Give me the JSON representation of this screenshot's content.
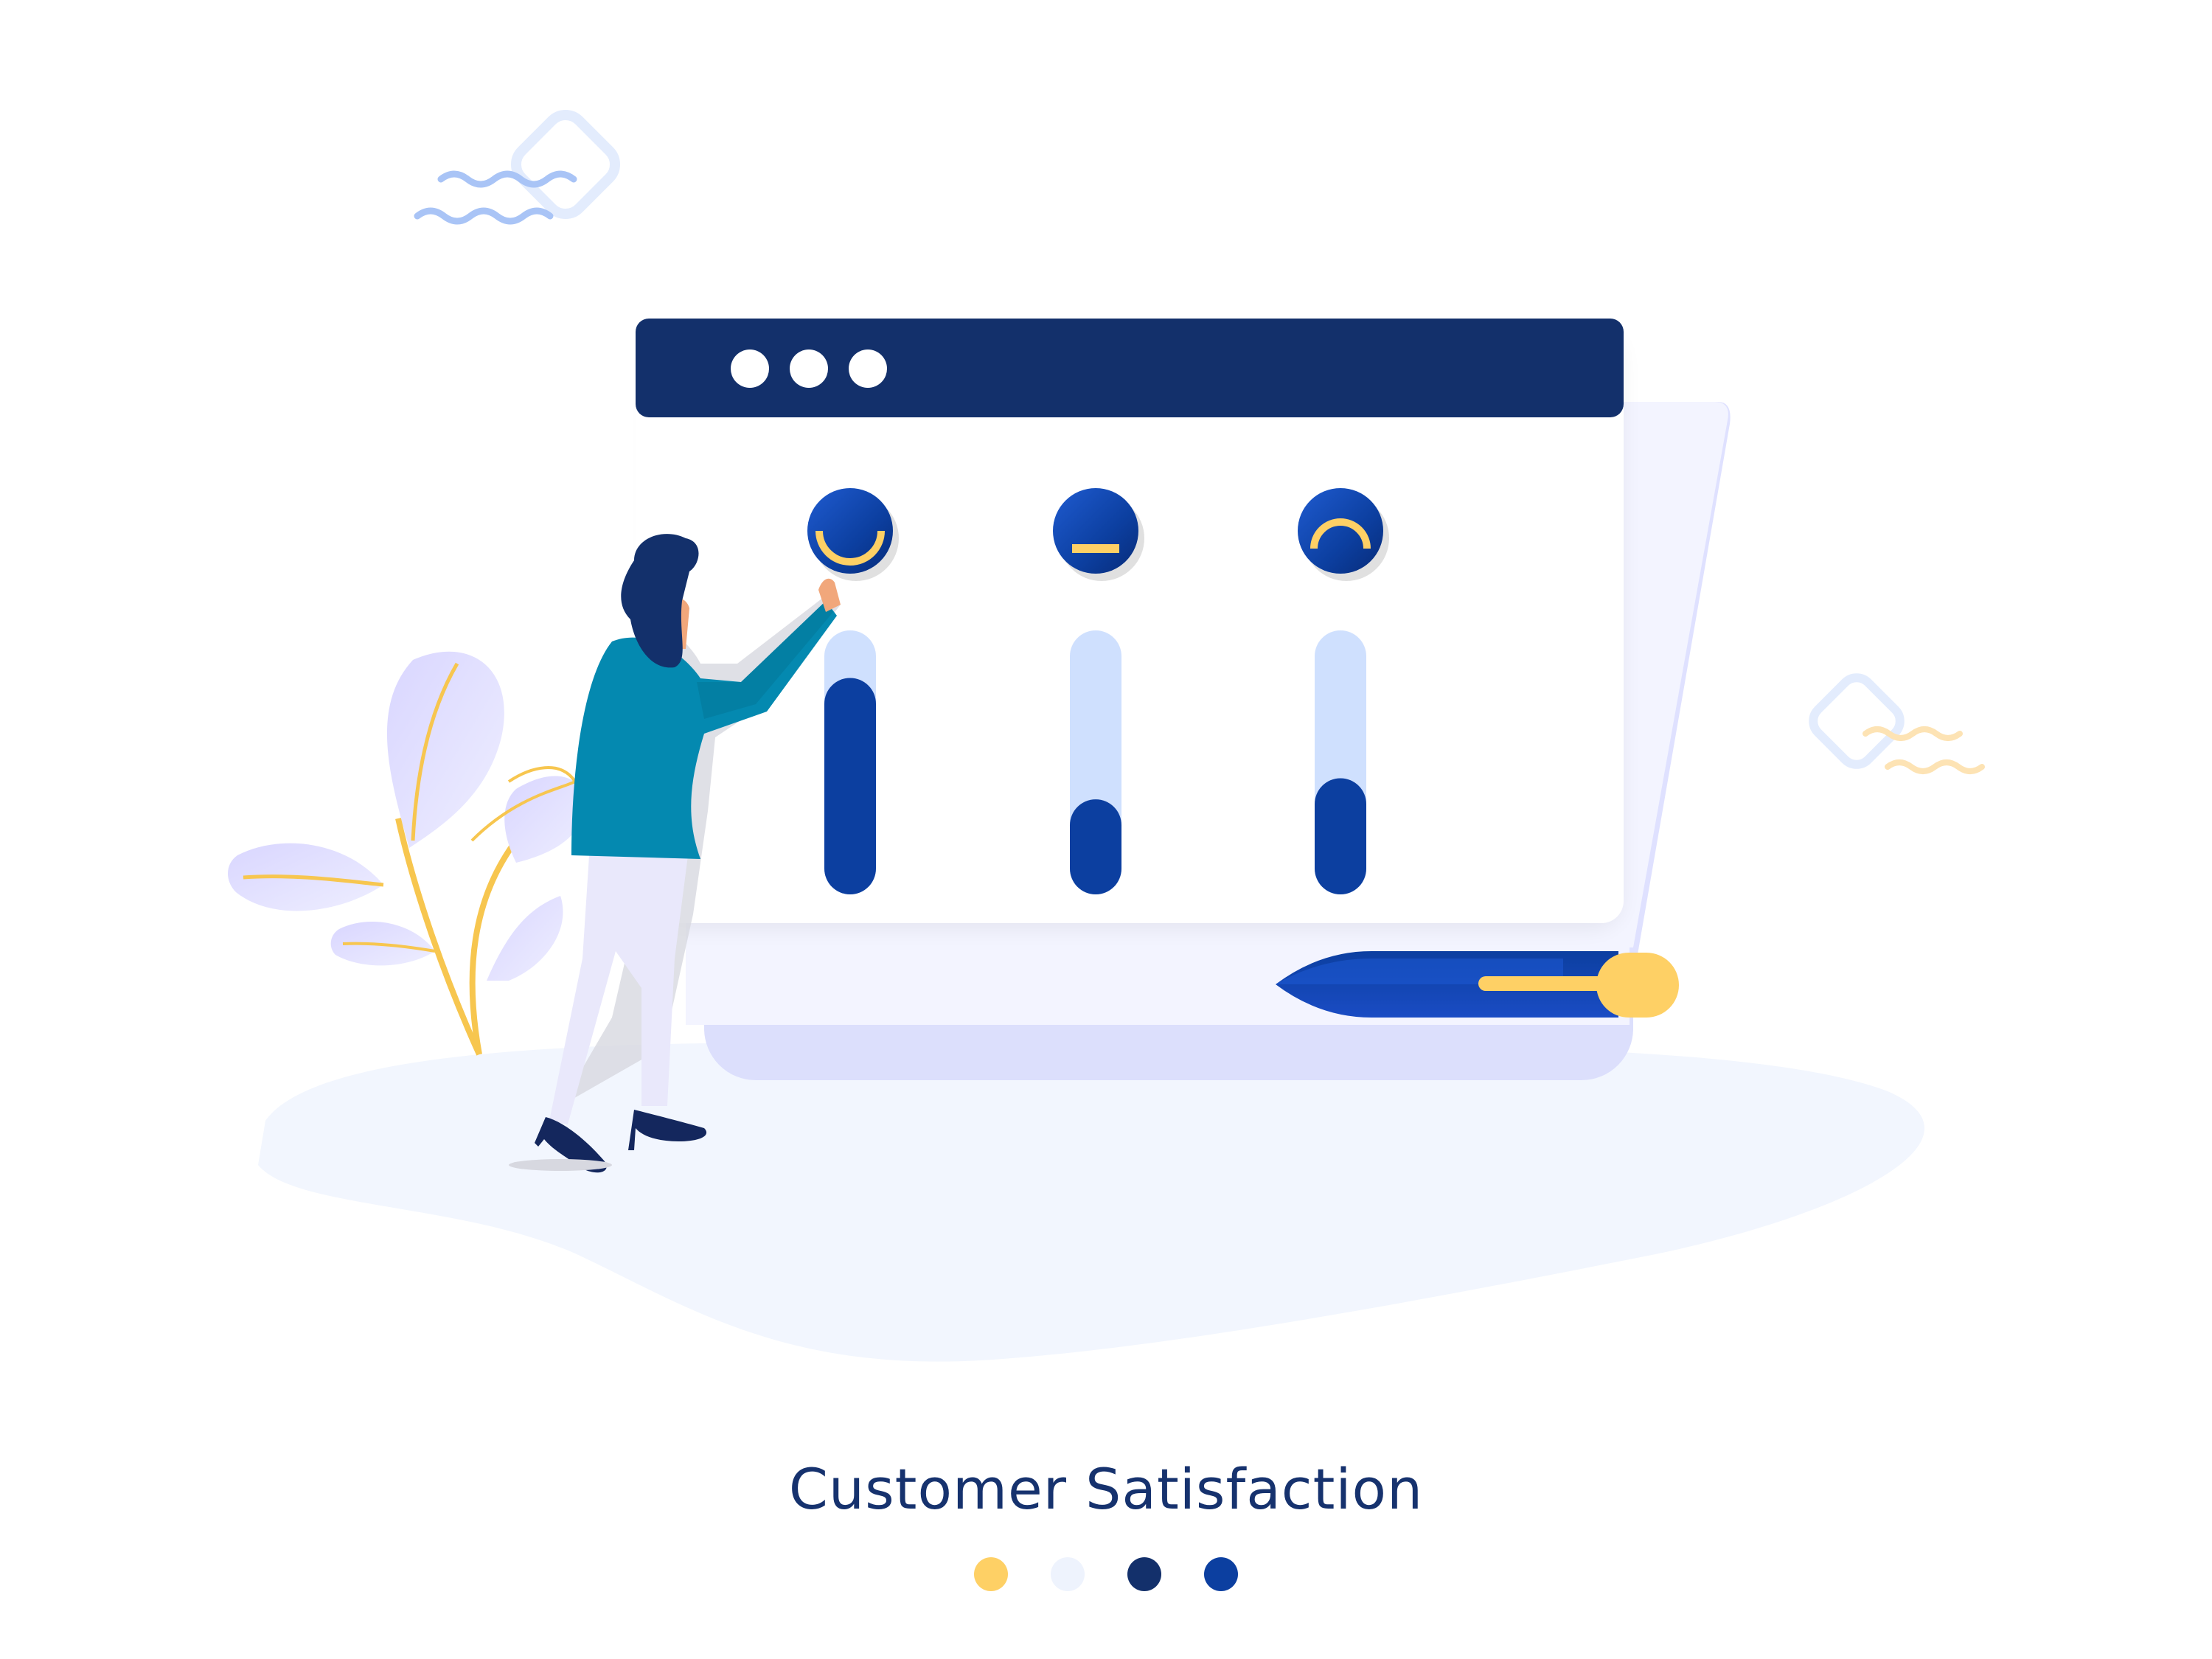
{
  "caption": {
    "title": "Customer Satisfaction"
  },
  "palette": [
    "#fed065",
    "#eef3fd",
    "#13306b",
    "#0c3fa0"
  ],
  "window": {
    "titlebar_color": "#13306b",
    "titlebar_dots": 3
  },
  "ratings": [
    {
      "name": "happy",
      "icon": "happy-face-icon",
      "level": 0.82
    },
    {
      "name": "neutral",
      "icon": "neutral-face-icon",
      "level": 0.36
    },
    {
      "name": "sad",
      "icon": "sad-face-icon",
      "level": 0.44
    }
  ],
  "colors": {
    "navy": "#13306b",
    "blue": "#0c3fa0",
    "track": "#cfe0fe",
    "accent": "#fed065",
    "ground": "#f2f6fe",
    "shirt": "#0489b0",
    "leaf": "#c7c9ff"
  }
}
